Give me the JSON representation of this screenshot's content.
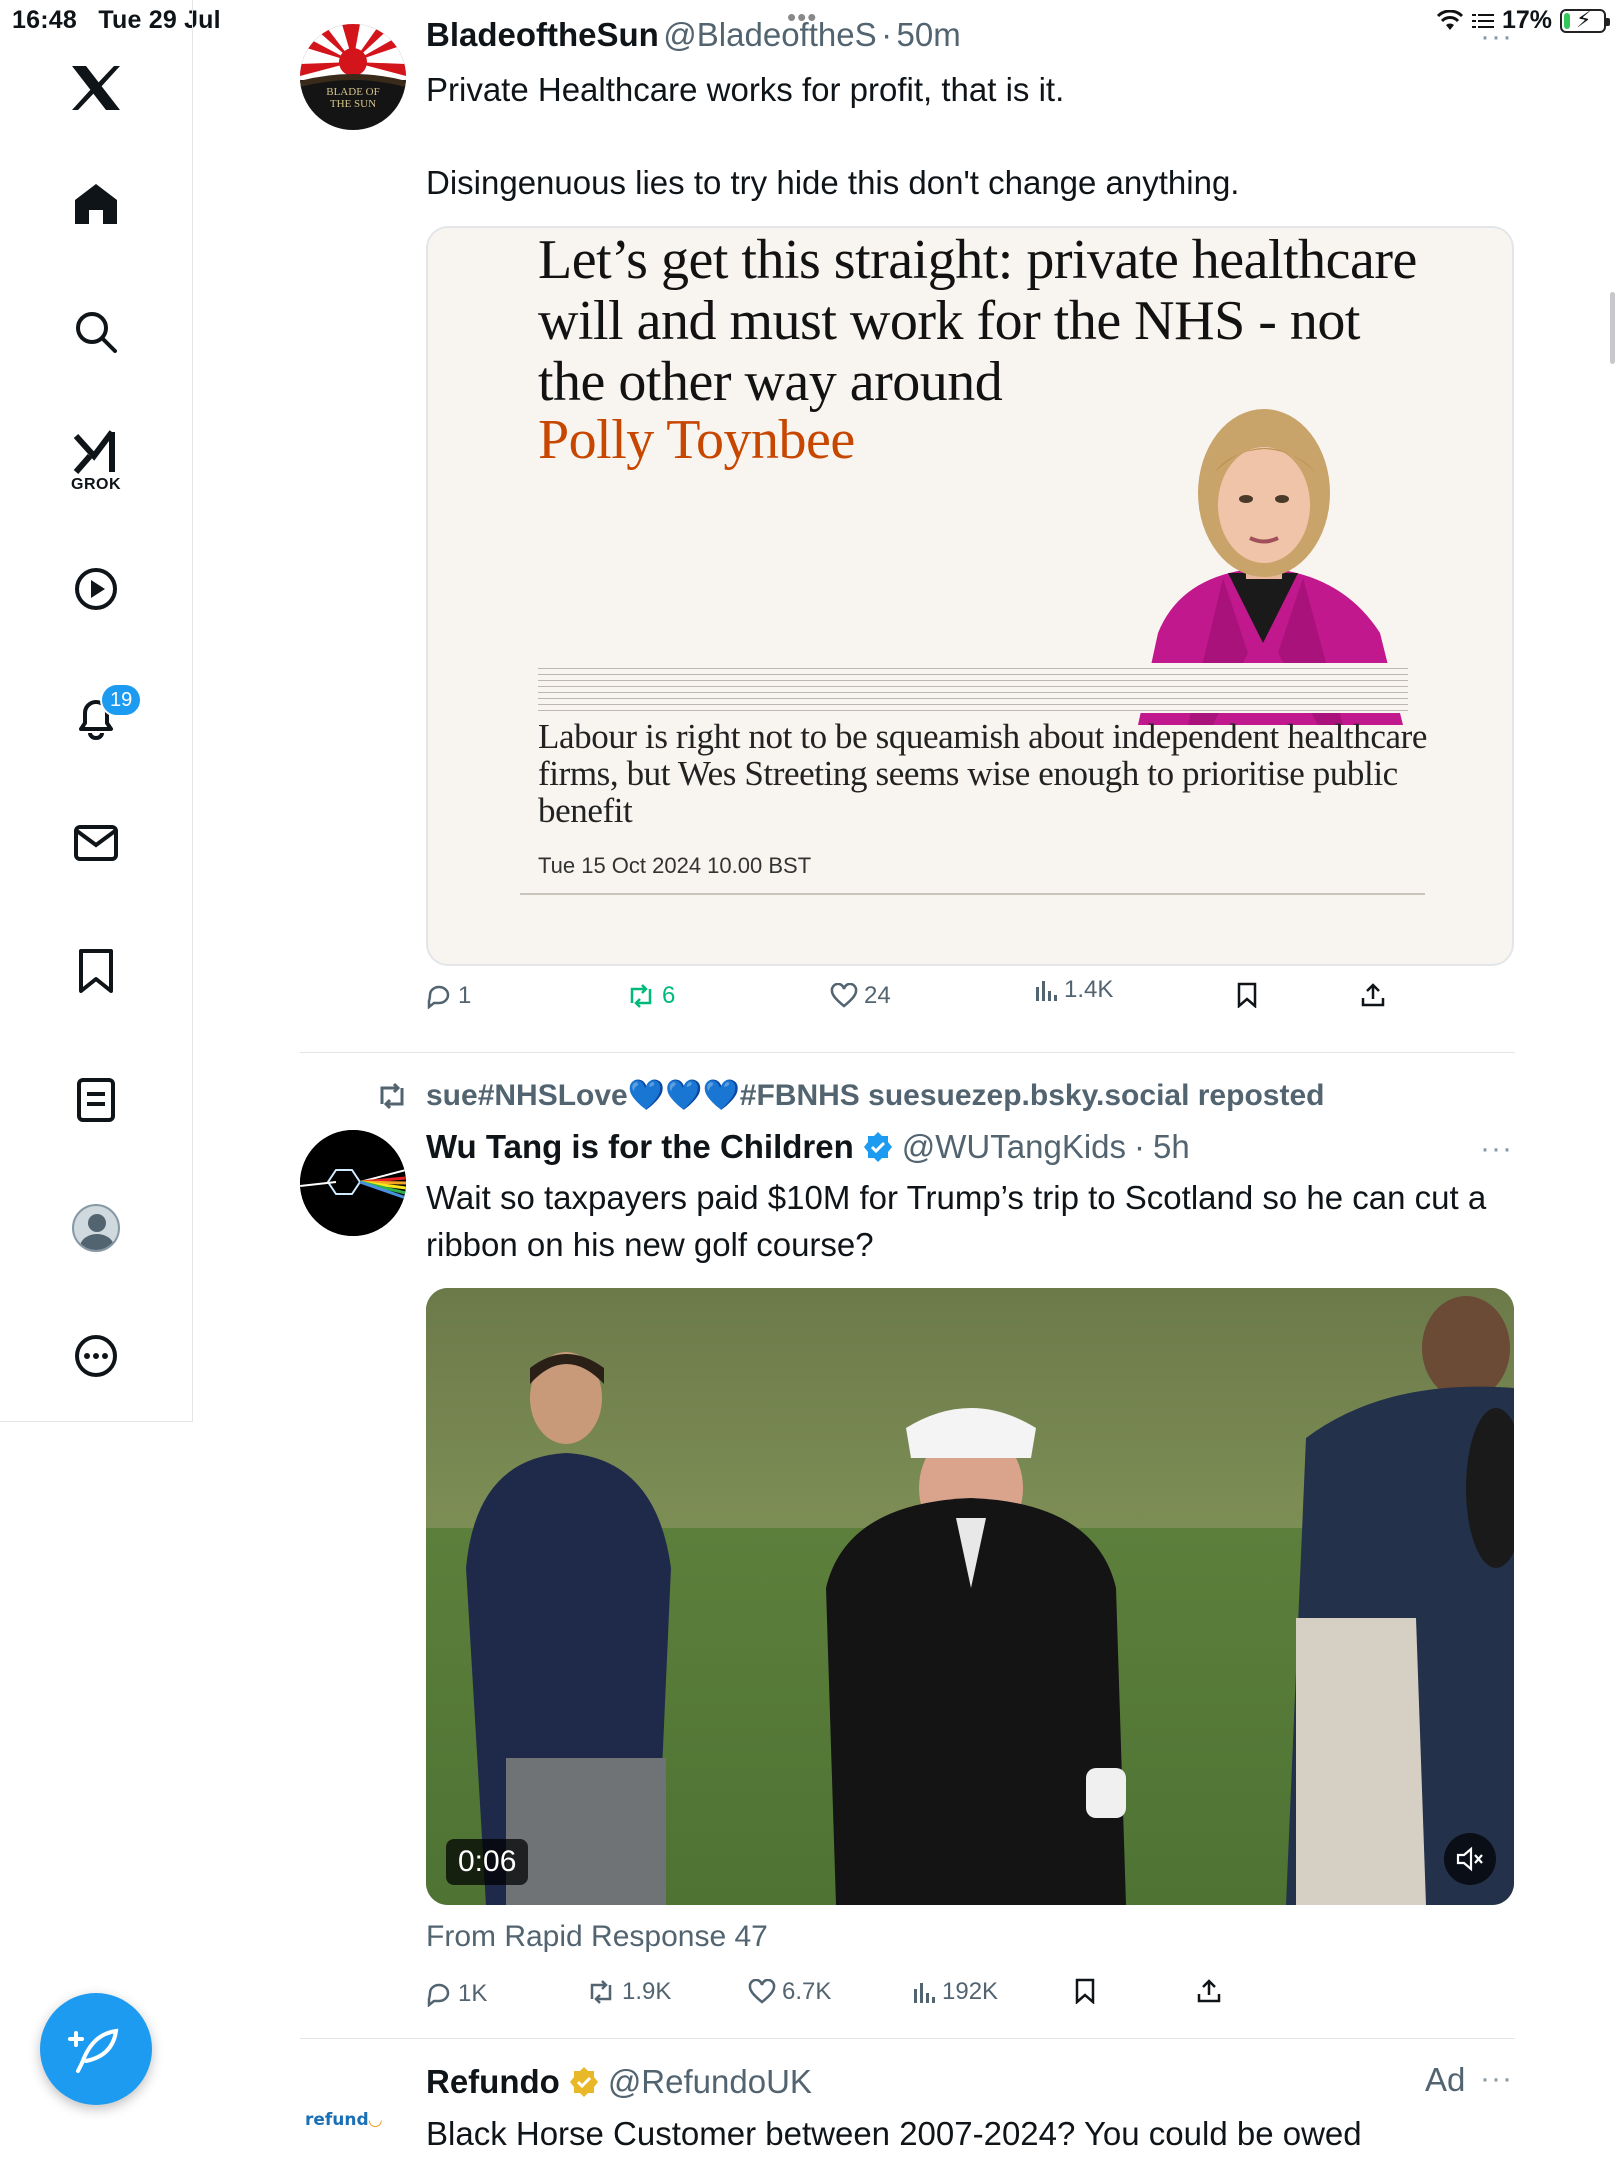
{
  "status_bar": {
    "time": "16:48",
    "date": "Tue 29 Jul",
    "battery": "17%",
    "battery_level": 0.17
  },
  "sidebar": {
    "grok_label": "GROK",
    "notification_count": "19",
    "accent_color": "#1d9bf0"
  },
  "posts": [
    {
      "author": "BladeoftheSun",
      "handle": "@BladeoftheS",
      "sep": "·",
      "time": "50m",
      "text_line1": "Private Healthcare works for profit, that is it.",
      "text_line2": "Disingenuous lies to try hide this don't change anything.",
      "avatar_text": "BLADE OF THE SUN",
      "article": {
        "headline": "Let’s get this straight: private healthcare will and must work for the NHS - not the other way around",
        "byline": "Polly Toynbee",
        "standfirst": "Labour is right not to be squeamish about independent healthcare firms, but Wes Streeting seems wise enough to prioritise public benefit",
        "date": "Tue 15 Oct 2024 10.00 BST"
      },
      "stats": {
        "replies": "1",
        "reposts": "6",
        "likes": "24",
        "views": "1.4K"
      }
    },
    {
      "repost_by": "sue#NHSLove💙💙💙#FBNHS suesuezep.bsky.social reposted",
      "author": "Wu Tang is for the Children",
      "handle": "@WUTangKids",
      "sep": "·",
      "time": "5h",
      "text": "Wait so taxpayers paid $10M for Trump’s trip to Scotland so he can cut a ribbon on his new golf course?",
      "video_time": "0:06",
      "from": "From Rapid Response 47",
      "stats": {
        "replies": "1K",
        "reposts": "1.9K",
        "likes": "6.7K",
        "views": "192K"
      }
    },
    {
      "author": "Refundo",
      "handle": "@RefundoUK",
      "ad_label": "Ad",
      "logo_text": "refund",
      "text": "Black Horse Customer between 2007-2024? You could be owed"
    }
  ]
}
